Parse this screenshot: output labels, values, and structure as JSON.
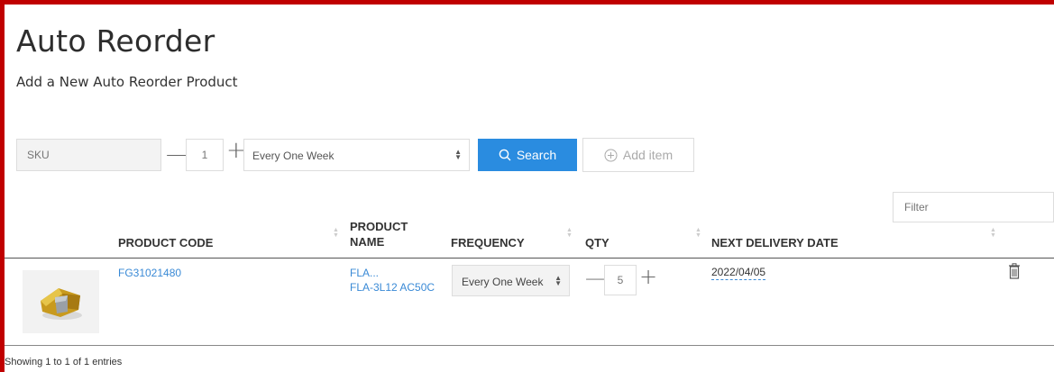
{
  "page": {
    "title": "Auto Reorder",
    "subtitle": "Add a New Auto Reorder Product"
  },
  "add_form": {
    "sku_placeholder": "SKU",
    "qty_value": "1",
    "frequency_selected": "Every One Week",
    "search_label": "Search",
    "add_item_label": "Add item"
  },
  "table": {
    "filter_placeholder": "Filter",
    "headers": {
      "product_code": "PRODUCT CODE",
      "product_name_line1": "PRODUCT",
      "product_name_line2": "NAME",
      "frequency": "FREQUENCY",
      "qty": "QTY",
      "next_delivery": "NEXT DELIVERY DATE"
    },
    "rows": [
      {
        "image_icon": "insert-product-image",
        "product_code": "FG31021480",
        "product_name_short": "FLA...",
        "product_name_full": "FLA-3L12 AC50C",
        "frequency": "Every One Week",
        "qty": "5",
        "next_delivery_date": "2022/04/05",
        "delete_icon": "trash-icon"
      }
    ],
    "footer_text": "Showing 1 to 1 of 1 entries"
  },
  "colors": {
    "accent_red": "#c00000",
    "primary_blue": "#2a8ce0",
    "link_blue": "#3a8ad6"
  }
}
